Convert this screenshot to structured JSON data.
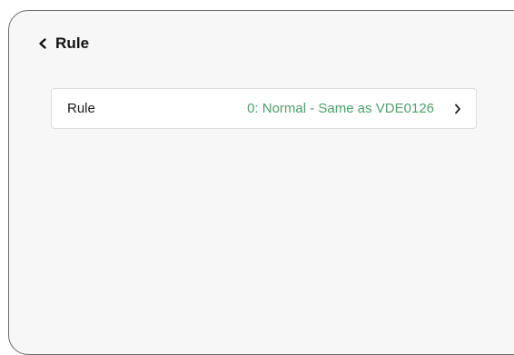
{
  "header": {
    "back_icon": "chevron-left-icon",
    "title": "Rule"
  },
  "settings": {
    "rows": [
      {
        "label": "Rule",
        "value": "0: Normal - Same as VDE0126",
        "icon": "chevron-right-icon"
      }
    ]
  },
  "colors": {
    "value_text": "#4fa06a",
    "background": "#f7f7f7",
    "row_background": "#ffffff",
    "frame_border": "#6b6b6b"
  }
}
